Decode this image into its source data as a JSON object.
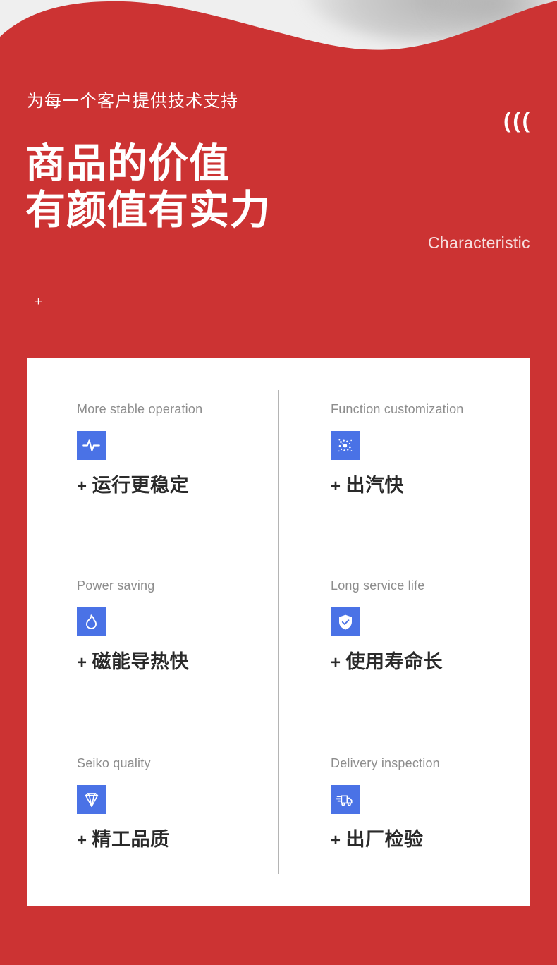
{
  "theme": {
    "red": "#cc3333",
    "blue": "#4a72e6",
    "card_bg": "#ffffff",
    "page_bg": "#efefef",
    "sub_text": "#8d8d8d",
    "title_text": "#2a2a2a"
  },
  "hero": {
    "eyebrow": "为每一个客户提供技术支持",
    "headline_line1": "商品的价值",
    "headline_line2": "有颜值有实力",
    "quote_marks": "(((",
    "side_label": "Characteristic",
    "plus_mark": "+"
  },
  "features": [
    {
      "subtitle": "More stable operation",
      "icon": "pulse-icon",
      "plus": "+",
      "title": "运行更稳定"
    },
    {
      "subtitle": "Function customization",
      "icon": "particles-icon",
      "plus": "+",
      "title": "出汽快"
    },
    {
      "subtitle": "Power saving",
      "icon": "flame-icon",
      "plus": "+",
      "title": "磁能导热快"
    },
    {
      "subtitle": "Long service life",
      "icon": "shield-check-icon",
      "plus": "+",
      "title": "使用寿命长"
    },
    {
      "subtitle": "Seiko quality",
      "icon": "diamond-icon",
      "plus": "+",
      "title": "精工品质"
    },
    {
      "subtitle": "Delivery inspection",
      "icon": "delivery-truck-icon",
      "plus": "+",
      "title": "出厂检验"
    }
  ]
}
